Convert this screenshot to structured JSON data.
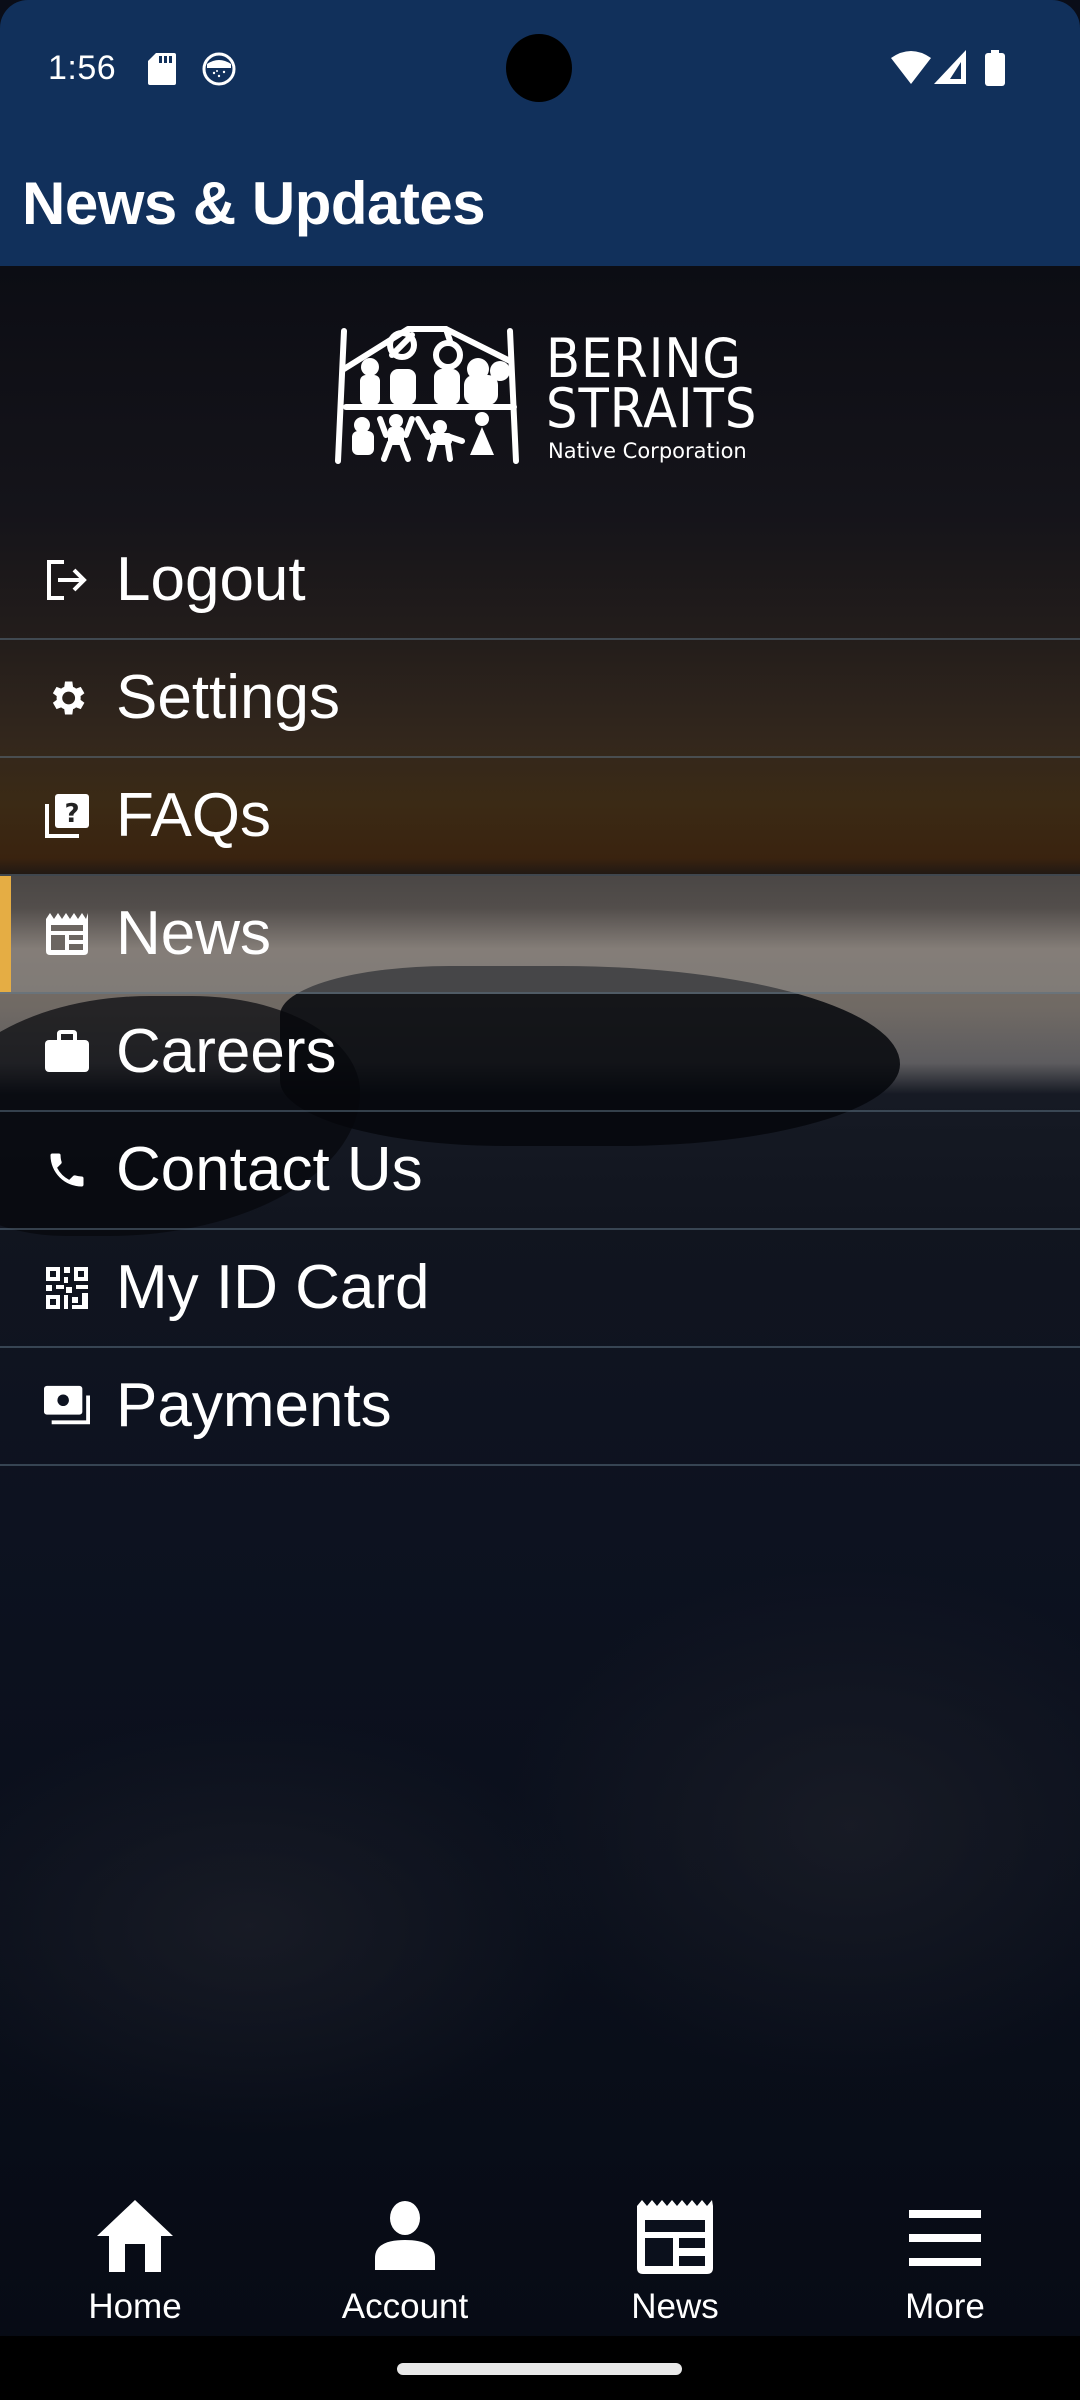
{
  "status_bar": {
    "time": "1:56",
    "left_icons": [
      "sd-card-icon",
      "notification-app-icon"
    ],
    "right_icons": [
      "wifi-icon",
      "cellular-signal-icon",
      "battery-icon"
    ]
  },
  "app_bar": {
    "title": "News & Updates",
    "background_color": "#11305b"
  },
  "logo": {
    "line1": "BERING",
    "line2": "STRAITS",
    "line3": "Native Corporation"
  },
  "menu": {
    "active_index": 3,
    "accent_color": "#e5ad44",
    "items": [
      {
        "label": "Logout",
        "icon": "logout-icon"
      },
      {
        "label": "Settings",
        "icon": "gear-icon"
      },
      {
        "label": "FAQs",
        "icon": "faq-icon"
      },
      {
        "label": "News",
        "icon": "newspaper-icon"
      },
      {
        "label": "Careers",
        "icon": "briefcase-icon"
      },
      {
        "label": "Contact Us",
        "icon": "phone-icon"
      },
      {
        "label": "My ID Card",
        "icon": "qr-code-icon"
      },
      {
        "label": "Payments",
        "icon": "payments-icon"
      }
    ]
  },
  "bottom_nav": {
    "items": [
      {
        "label": "Home",
        "icon": "home-icon"
      },
      {
        "label": "Account",
        "icon": "person-icon"
      },
      {
        "label": "News",
        "icon": "newspaper-icon"
      },
      {
        "label": "More",
        "icon": "menu-icon"
      }
    ]
  }
}
